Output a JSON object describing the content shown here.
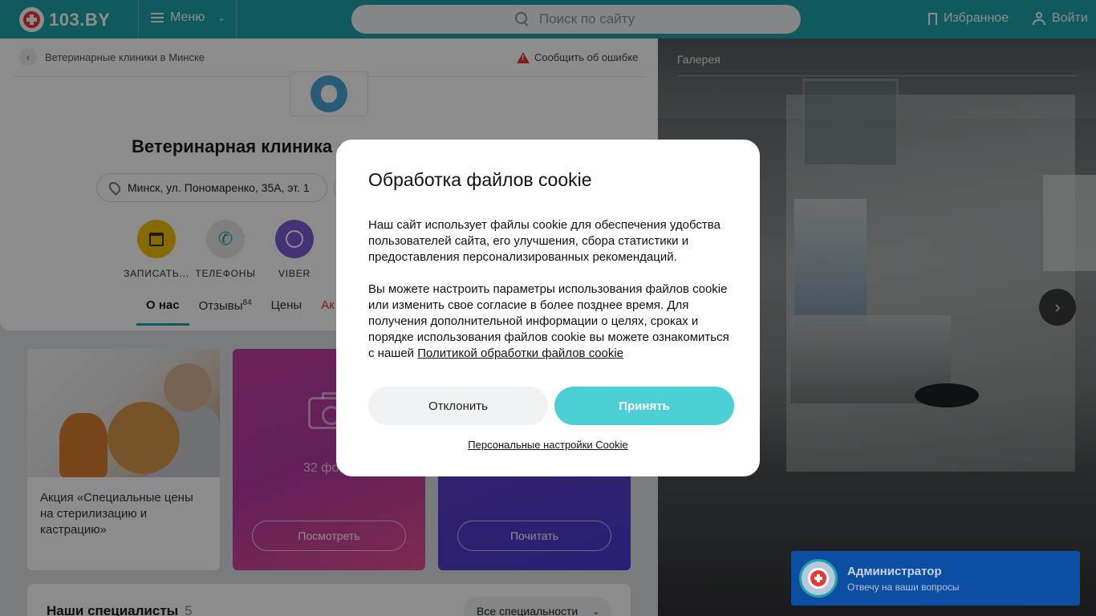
{
  "header": {
    "logo_text": "103.BY",
    "menu_label": "Меню",
    "search_placeholder": "Поиск по сайту",
    "favorites_label": "Избранное",
    "login_label": "Войти"
  },
  "breadcrumb": {
    "label": "Ветеринарные клиники в Минске"
  },
  "report_error": "Сообщить об ошибке",
  "clinic": {
    "title": "Ветеринарная клиника «",
    "address": "Минск, ул. Пономаренко, 35А, эт. 1"
  },
  "actions": [
    {
      "label": "ЗАПИСАТЬ...",
      "color": "#f2c200"
    },
    {
      "label": "ТЕЛЕФОНЫ",
      "color": "#e6e8ea"
    },
    {
      "label": "VIBER",
      "color": "#7b5cd6"
    }
  ],
  "tabs": [
    {
      "label": "О нас",
      "active": true
    },
    {
      "label": "Отзывы",
      "badge": "84"
    },
    {
      "label": "Цены"
    },
    {
      "label": "Ак"
    }
  ],
  "promos": {
    "promo1_text": "Акция «Специальные цены на стерилизацию и кастрацию»",
    "promo2_count": "32 фо",
    "promo2_button": "Посмотреть",
    "promo3_button": "Почитать"
  },
  "specialists": {
    "title": "Наши специалисты",
    "count": "5",
    "filter": "Все специальности"
  },
  "gallery": {
    "title": "Галерея"
  },
  "chat": {
    "name": "Администратор",
    "subtitle": "Отвечу на ваши вопросы"
  },
  "cookie_modal": {
    "title": "Обработка файлов cookie",
    "paragraph1": "Наш сайт использует файлы cookie для обеспечения удобства пользователей сайта, его улучшения, сбора статистики и предоставления персонализированных рекомендаций.",
    "paragraph2": "Вы можете настроить параметры использования файлов cookie или изменить свое согласие в более позднее время. Для получения дополнительной информации о целях, сроках и порядке использования файлов cookie вы можете ознакомиться с нашей",
    "policy_link": "Политикой обработки файлов cookie",
    "decline_label": "Отклонить",
    "accept_label": "Принять",
    "settings_link": "Персональные настройки Cookie",
    "accent_color": "#4ccfd5"
  },
  "colors": {
    "brand": "#1ea3a8",
    "alert": "#e53935"
  }
}
